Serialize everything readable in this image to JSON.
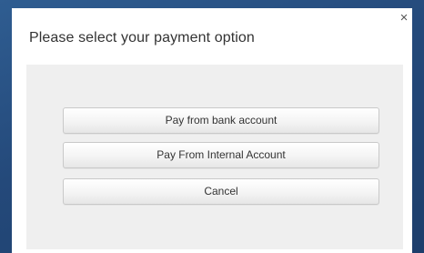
{
  "dialog": {
    "title": "Please select your payment option",
    "close_label": "×"
  },
  "options": [
    {
      "label": "Pay from bank account"
    },
    {
      "label": "Pay From Internal Account"
    },
    {
      "label": "Cancel"
    }
  ],
  "colors": {
    "backdrop": "#24497a",
    "dialog_bg": "#ffffff",
    "panel_bg": "#efefef",
    "button_border": "#c9c9c9",
    "text": "#333333"
  }
}
